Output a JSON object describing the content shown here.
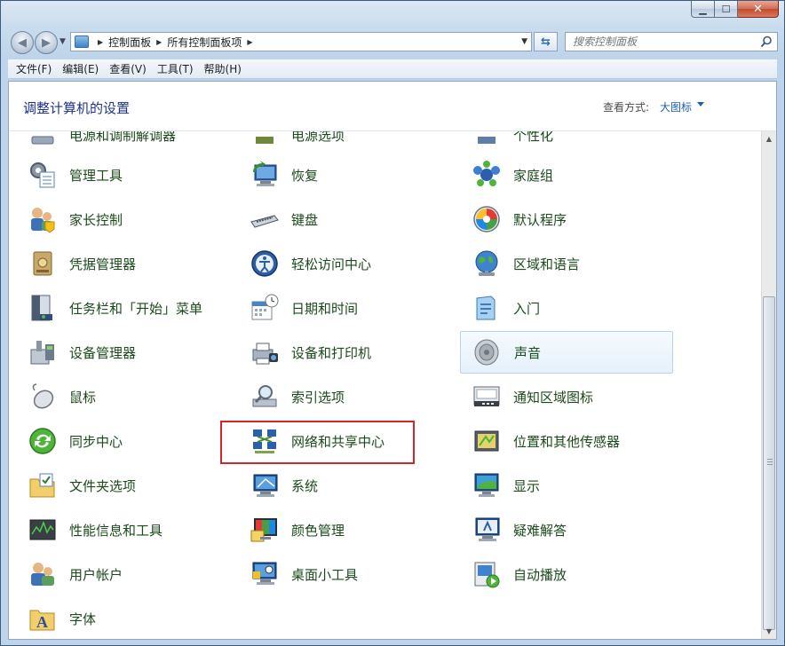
{
  "window": {
    "minimize": "▁",
    "maximize": "☐",
    "close": "✕"
  },
  "nav": {
    "breadcrumbs": [
      "控制面板",
      "所有控制面板项"
    ],
    "search_placeholder": "搜索控制面板"
  },
  "menu": [
    "文件(F)",
    "编辑(E)",
    "查看(V)",
    "工具(T)",
    "帮助(H)"
  ],
  "header": {
    "title": "调整计算机的设置",
    "view_by_label": "查看方式:",
    "view_by_value": "大图标"
  },
  "items": {
    "partial_top": [
      "电源和调制解调器",
      "电源选项",
      "个性化"
    ],
    "col1": [
      "管理工具",
      "家长控制",
      "凭据管理器",
      "任务栏和「开始」菜单",
      "设备管理器",
      "鼠标",
      "同步中心",
      "文件夹选项",
      "性能信息和工具",
      "用户帐户",
      "字体"
    ],
    "col2": [
      "恢复",
      "键盘",
      "轻松访问中心",
      "日期和时间",
      "设备和打印机",
      "索引选项",
      "网络和共享中心",
      "系统",
      "颜色管理",
      "桌面小工具"
    ],
    "col3": [
      "家庭组",
      "默认程序",
      "区域和语言",
      "入门",
      "声音",
      "通知区域图标",
      "位置和其他传感器",
      "显示",
      "疑难解答",
      "自动播放"
    ]
  },
  "colors": {
    "label_text": "#1a4b1a",
    "title_text": "#1e3287",
    "highlight": "#d6252a"
  }
}
